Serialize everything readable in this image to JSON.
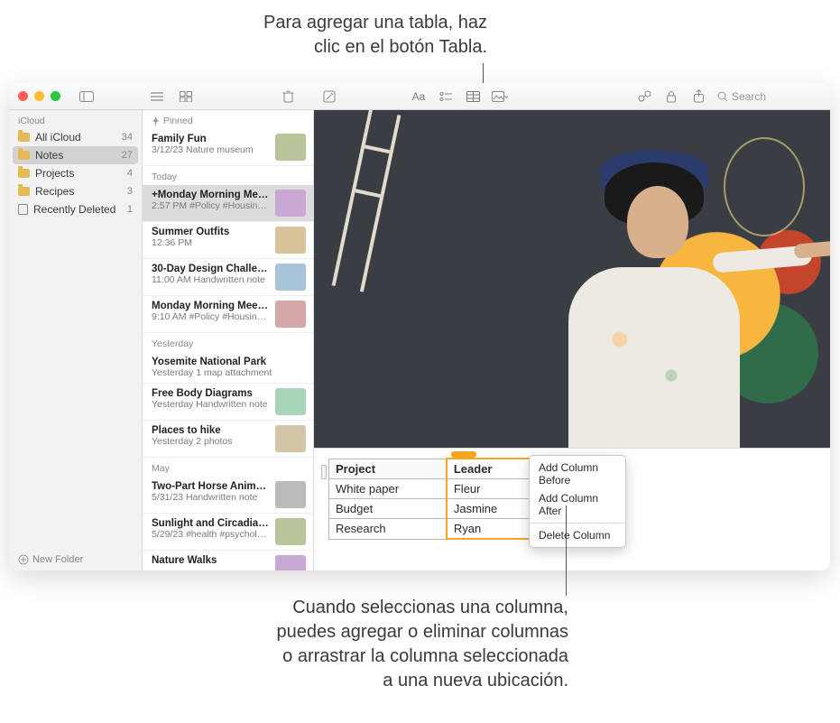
{
  "callouts": {
    "top": "Para agregar una tabla, haz\nclic en el botón Tabla.",
    "bottom": "Cuando seleccionas una columna,\npuedes agregar o eliminar columnas\no arrastrar la columna seleccionada\na una nueva ubicación."
  },
  "toolbar": {
    "search_placeholder": "Search"
  },
  "sidebar": {
    "section": "iCloud",
    "items": [
      {
        "label": "All iCloud",
        "count": "34",
        "icon": "folder"
      },
      {
        "label": "Notes",
        "count": "27",
        "icon": "folder",
        "selected": true
      },
      {
        "label": "Projects",
        "count": "4",
        "icon": "folder"
      },
      {
        "label": "Recipes",
        "count": "3",
        "icon": "folder"
      },
      {
        "label": "Recently Deleted",
        "count": "1",
        "icon": "trash"
      }
    ],
    "footer": "New Folder"
  },
  "noteslist": {
    "sections": [
      {
        "label": "Pinned",
        "icon": "pin",
        "items": [
          {
            "title": "Family Fun",
            "sub": "3/12/23  Nature museum"
          }
        ]
      },
      {
        "label": "Today",
        "items": [
          {
            "title": "+Monday Morning Mee…",
            "sub": "2:57 PM  #Policy #Housing…",
            "selected": true
          },
          {
            "title": "Summer Outfits",
            "sub": "12:36 PM"
          },
          {
            "title": "30-Day Design Challen…",
            "sub": "11:00 AM  Handwritten note"
          },
          {
            "title": "Monday Morning Meeting",
            "sub": "9:10 AM  #Policy #Housing…"
          }
        ]
      },
      {
        "label": "Yesterday",
        "items": [
          {
            "title": "Yosemite National Park",
            "sub": "Yesterday  1 map attachment",
            "nothumb": true
          },
          {
            "title": "Free Body Diagrams",
            "sub": "Yesterday  Handwritten note"
          },
          {
            "title": "Places to hike",
            "sub": "Yesterday  2 photos"
          }
        ]
      },
      {
        "label": "May",
        "items": [
          {
            "title": "Two-Part Horse Anima…",
            "sub": "5/31/23  Handwritten note"
          },
          {
            "title": "Sunlight and Circadian…",
            "sub": "5/29/23  #health #psycholo…"
          },
          {
            "title": "Nature Walks",
            "sub": ""
          }
        ]
      }
    ]
  },
  "table": {
    "headers": [
      "Project",
      "Leader"
    ],
    "rows": [
      [
        "White paper",
        "Fleur"
      ],
      [
        "Budget",
        "Jasmine"
      ],
      [
        "Research",
        "Ryan"
      ]
    ],
    "selected_column_index": 1
  },
  "context_menu": {
    "items": [
      "Add Column Before",
      "Add Column After",
      "Delete Column"
    ],
    "separator_after_index": 1
  }
}
